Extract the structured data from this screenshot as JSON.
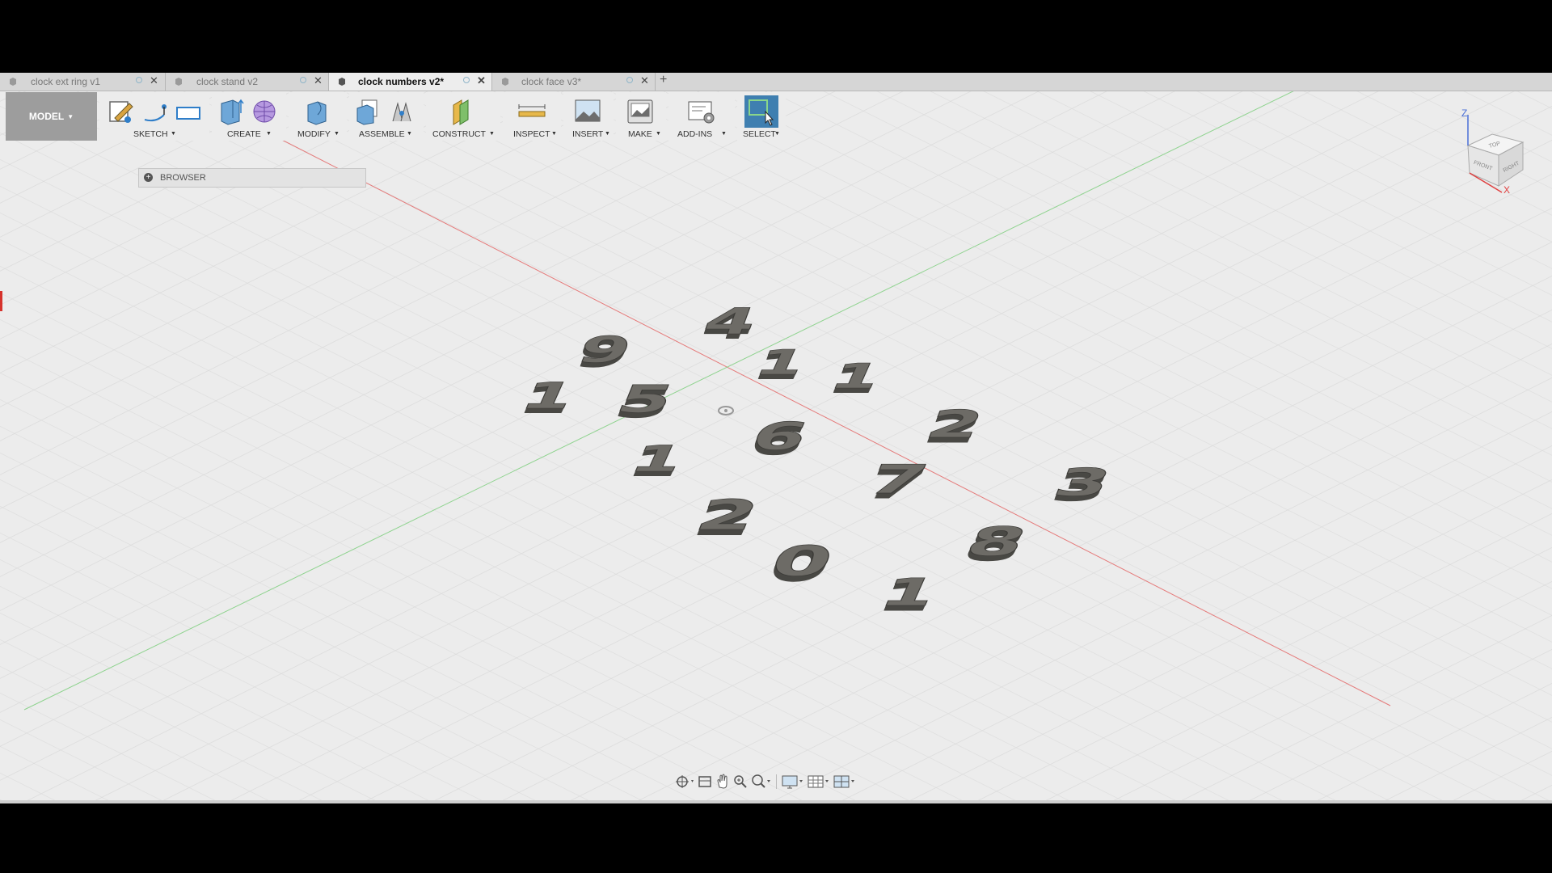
{
  "tabs": [
    {
      "label": "clock ext ring v1",
      "active": false
    },
    {
      "label": "clock stand v2",
      "active": false
    },
    {
      "label": "clock numbers v2*",
      "active": true
    },
    {
      "label": "clock face v3*",
      "active": false
    }
  ],
  "new_tab": "+",
  "toolbar": {
    "workspace": "MODEL",
    "groups": [
      "SKETCH",
      "CREATE",
      "MODIFY",
      "ASSEMBLE",
      "CONSTRUCT",
      "INSPECT",
      "INSERT",
      "MAKE",
      "ADD-INS",
      "SELECT"
    ]
  },
  "browser": {
    "label": "BROWSER"
  },
  "viewcube": {
    "axis_z": "Z",
    "axis_x": "X",
    "face_top": "TOP",
    "face_front": "FRONT",
    "face_right": "RIGHT"
  },
  "numerals": [
    "9",
    "4",
    "1",
    "1",
    "1",
    "5",
    "6",
    "2",
    "1",
    "7",
    "3",
    "2",
    "8",
    "0",
    "1"
  ],
  "colors": {
    "viewport_bg": "#ececec",
    "grid": "#d9d9d9",
    "x_axis": "#e57a7a",
    "y_axis": "#8fd38f",
    "digit_face": "#6d6b66",
    "digit_side": "#494844",
    "select_active": "#3f7fb0"
  }
}
